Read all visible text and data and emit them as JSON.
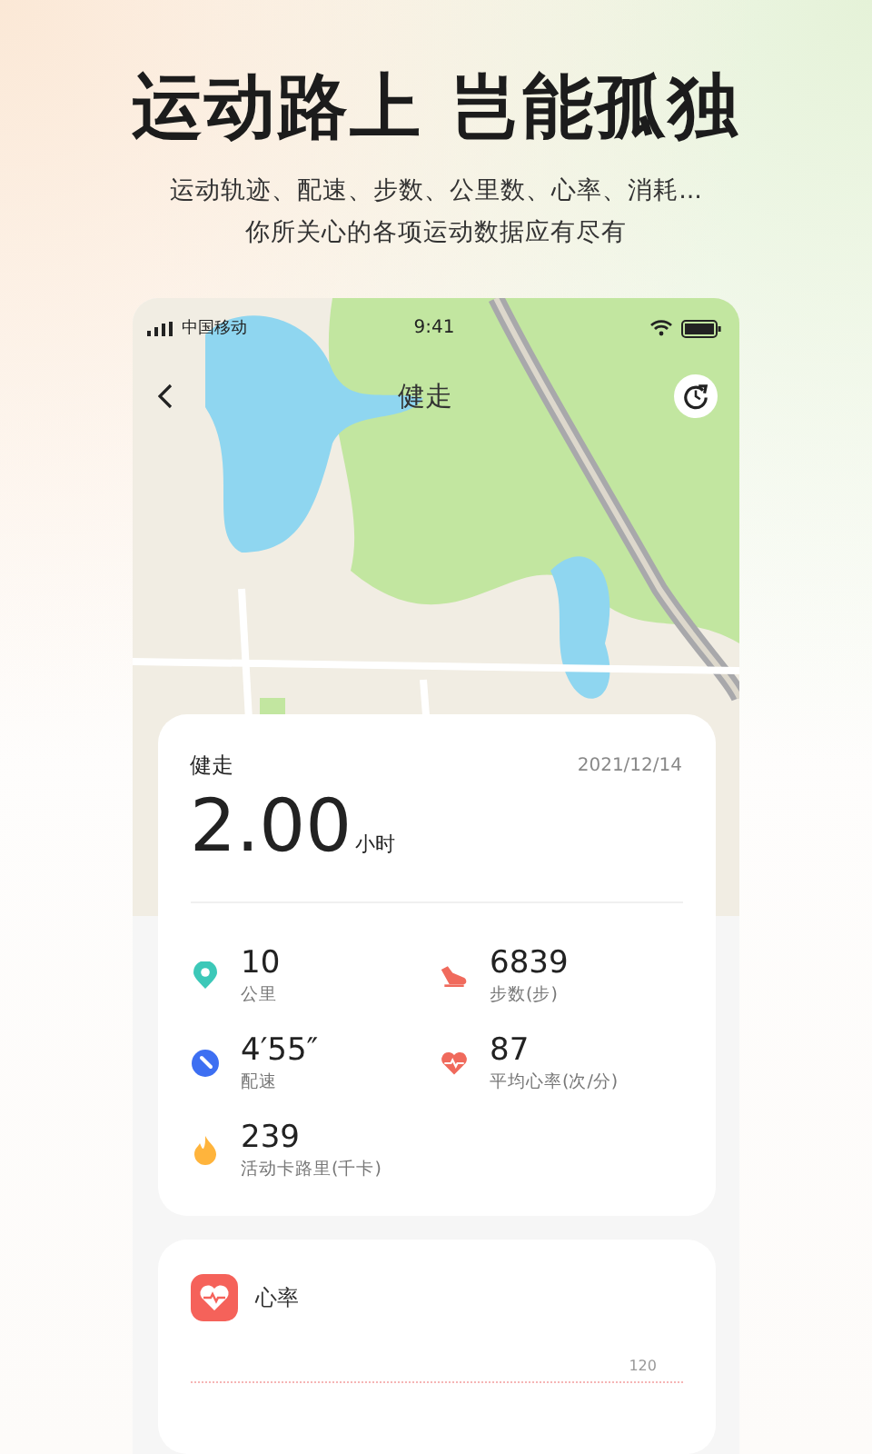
{
  "headline": "运动路上 岂能孤独",
  "subtitle": [
    "运动轨迹、配速、步数、公里数、心率、消耗...",
    "你所关心的各项运动数据应有尽有"
  ],
  "phone": {
    "status_bar": {
      "carrier": "中国移动",
      "time": "9:41"
    },
    "nav": {
      "title": "健走"
    },
    "summary": {
      "activity": "健走",
      "date": "2021/12/14",
      "duration": "2.00",
      "duration_unit": "小时",
      "stats": [
        {
          "kind": "distance",
          "value": "10",
          "label": "公里"
        },
        {
          "kind": "steps",
          "value": "6839",
          "label": "步数(步)"
        },
        {
          "kind": "pace",
          "value": "4′55″",
          "label": "配速"
        },
        {
          "kind": "heart",
          "value": "87",
          "label": "平均心率(次/分)"
        },
        {
          "kind": "calories",
          "value": "239",
          "label": "活动卡路里(千卡)"
        }
      ]
    },
    "heart_rate": {
      "title": "心率",
      "axis_label": "120"
    }
  }
}
